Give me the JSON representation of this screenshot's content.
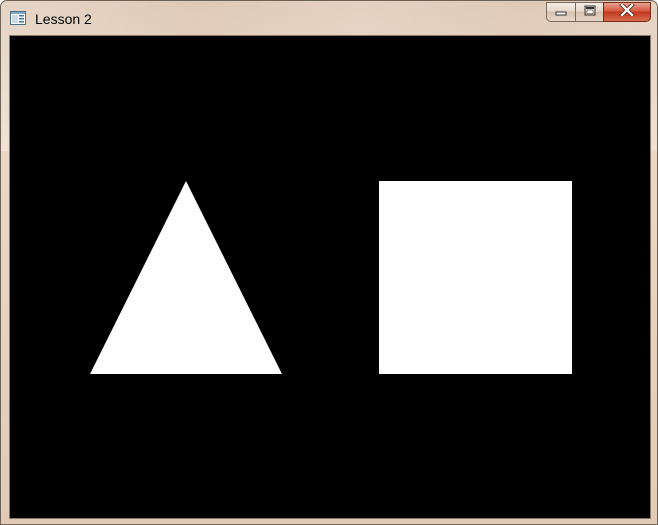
{
  "window": {
    "title": "Lesson 2",
    "caption_buttons": {
      "minimize_icon": "minimize-icon",
      "maximize_icon": "maximize-icon",
      "close_icon": "close-icon"
    }
  },
  "canvas": {
    "background_color": "#000000",
    "shapes": [
      {
        "kind": "triangle",
        "fill": "#ffffff"
      },
      {
        "kind": "square",
        "fill": "#ffffff"
      }
    ]
  }
}
